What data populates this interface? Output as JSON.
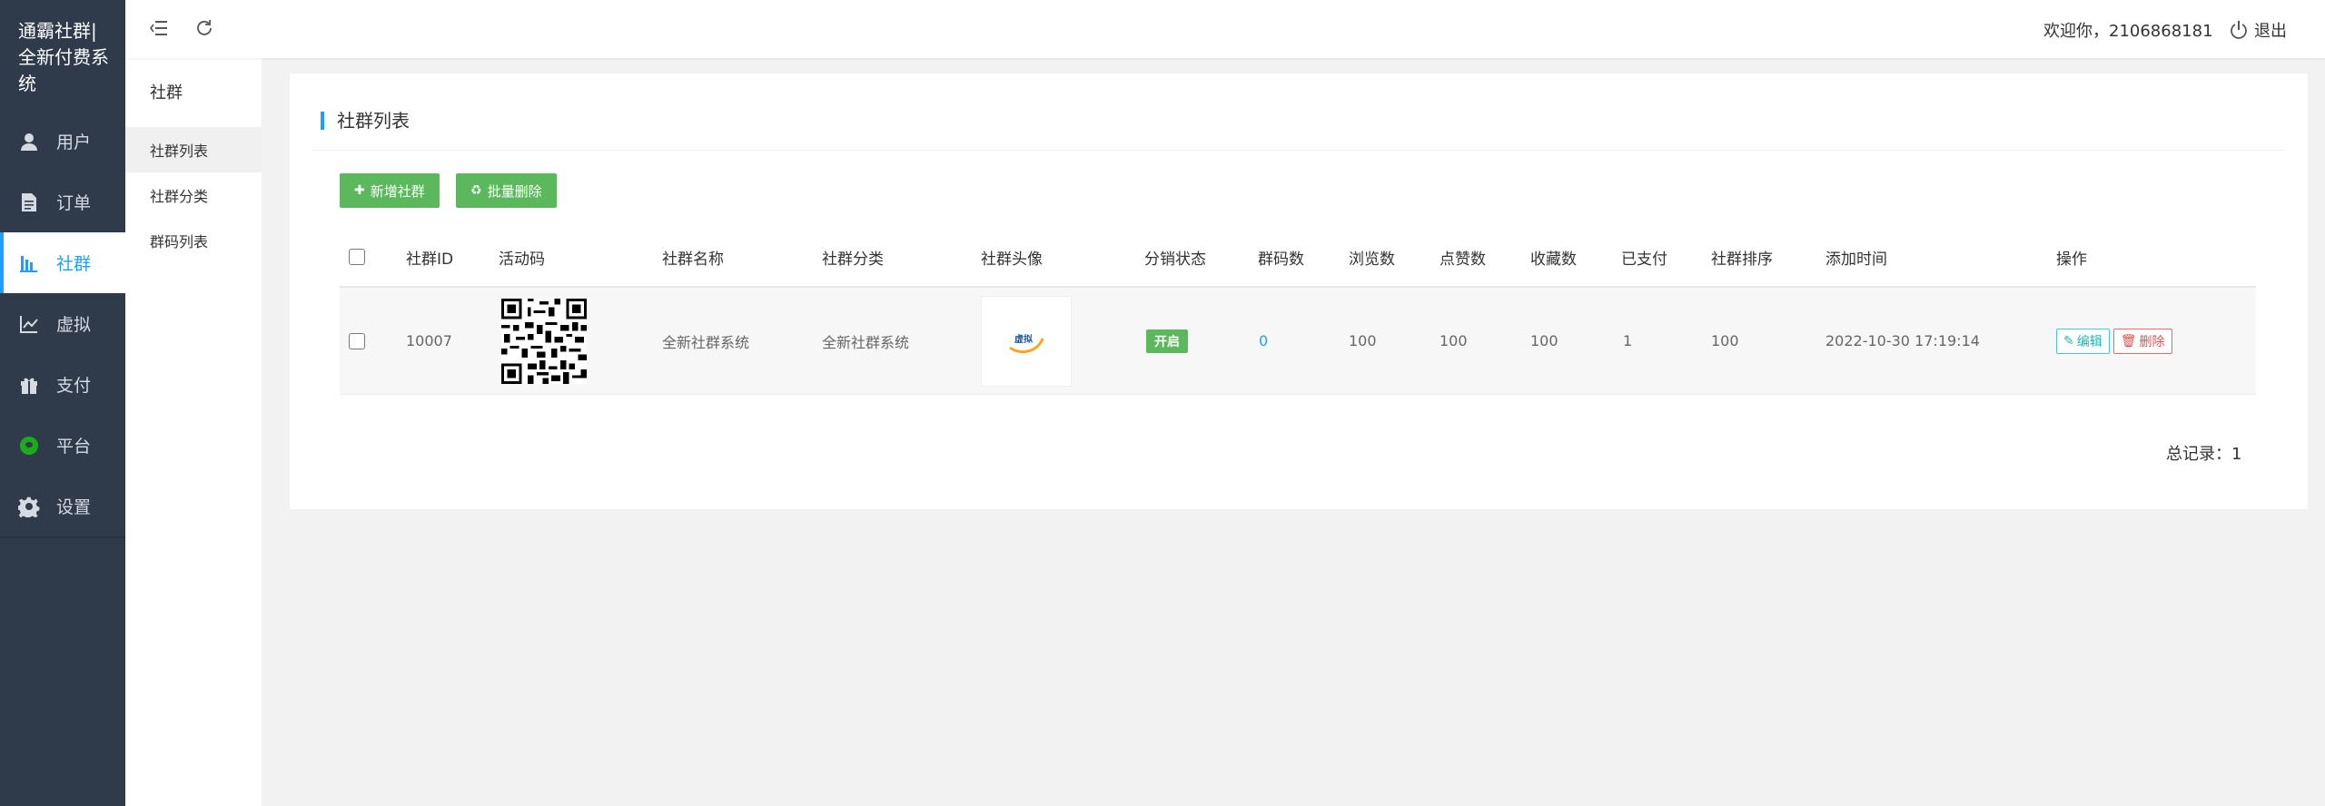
{
  "brand": {
    "line1": "通霸社群|",
    "line2": "全新付费系",
    "line3": "统"
  },
  "sidebar": {
    "items": [
      {
        "label": "用户",
        "icon": "user-icon"
      },
      {
        "label": "订单",
        "icon": "document-icon"
      },
      {
        "label": "社群",
        "icon": "bars-icon"
      },
      {
        "label": "虚拟",
        "icon": "chart-line-icon"
      },
      {
        "label": "支付",
        "icon": "gift-icon"
      },
      {
        "label": "平台",
        "icon": "platform-icon"
      },
      {
        "label": "设置",
        "icon": "gear-icon"
      }
    ],
    "active": "社群"
  },
  "subnav": {
    "title": "社群",
    "items": [
      {
        "label": "社群列表"
      },
      {
        "label": "社群分类"
      },
      {
        "label": "群码列表"
      }
    ]
  },
  "topbar": {
    "welcome": "欢迎你，2106868181",
    "logout": "退出"
  },
  "card": {
    "title": "社群列表",
    "add_button": "新增社群",
    "batch_delete_button": "批量删除"
  },
  "table": {
    "headers": [
      "社群ID",
      "活动码",
      "社群名称",
      "社群分类",
      "社群头像",
      "分销状态",
      "群码数",
      "浏览数",
      "点赞数",
      "收藏数",
      "已支付",
      "社群排序",
      "添加时间",
      "操作"
    ],
    "rows": [
      {
        "id": "10007",
        "name": "全新社群系统",
        "category": "全新社群系统",
        "avatar_text": "虚拟",
        "status": "开启",
        "code_count": "0",
        "views": "100",
        "likes": "100",
        "favorites": "100",
        "paid": "1",
        "sort": "100",
        "added_time": "2022-10-30 17:19:14",
        "edit_label": "编辑",
        "delete_label": "删除"
      }
    ]
  },
  "footer": {
    "total": "总记录：1"
  },
  "colors": {
    "sidebar_bg": "#2f3a4b",
    "accent": "#1e9fff",
    "green": "#5cb85c"
  }
}
